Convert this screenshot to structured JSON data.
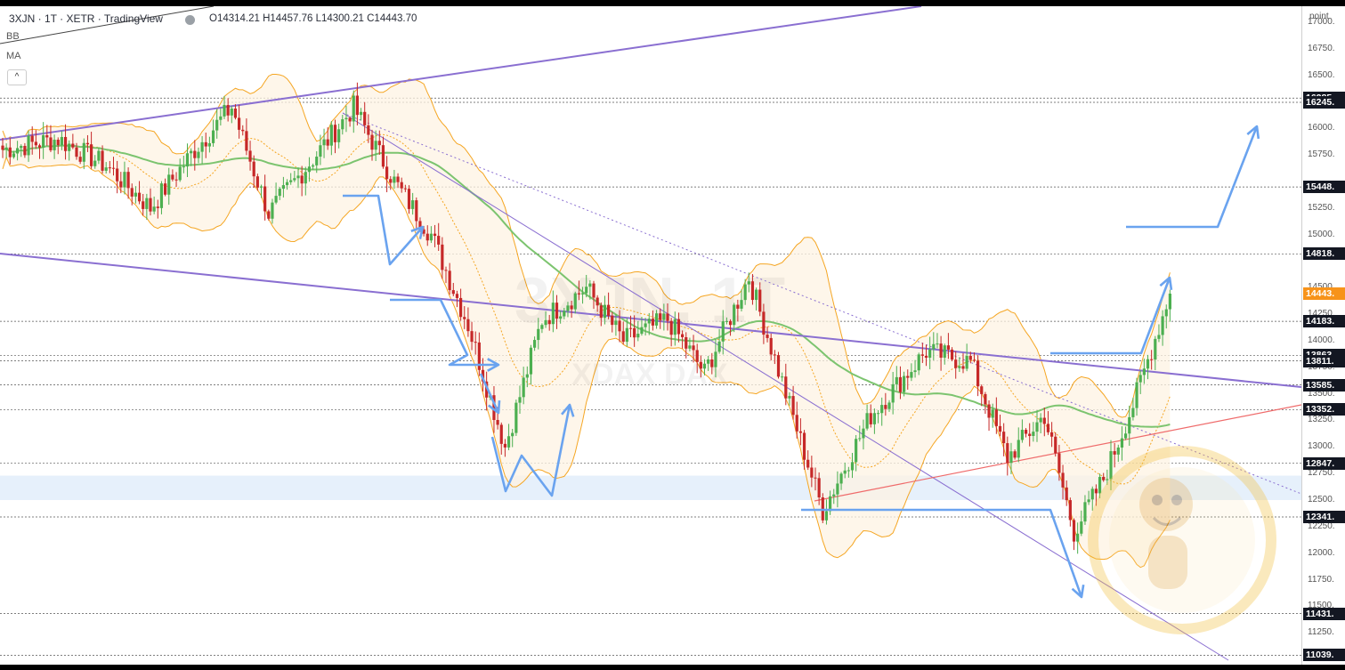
{
  "header": {
    "symbol": "3XJN · 1T · XETR · TradingView",
    "ohlc": "O14314.21 H14457.76 L14300.21 C14443.70"
  },
  "indicators": [
    "BB",
    "MA"
  ],
  "collapse_icon": "chevron-up-icon",
  "watermark": {
    "title": "3XJN, 1T",
    "subtitle": "XDAX DAX"
  },
  "axis": {
    "unit": "point",
    "ticks": [
      "17000.",
      "16750.",
      "16500.",
      "16000.",
      "15750.",
      "15250.",
      "15000.",
      "14500.",
      "14250.",
      "14000.",
      "13750.",
      "13500.",
      "13250.",
      "13000.",
      "12750.",
      "12500.",
      "12250.",
      "12000.",
      "11750.",
      "11500.",
      "11250."
    ],
    "price_labels": [
      "16285.",
      "16245.",
      "15448.",
      "14818.",
      "14443.",
      "14183.",
      "13863.",
      "13811.",
      "13585.",
      "13352.",
      "12847.",
      "12341.",
      "11431.",
      "11039."
    ],
    "current_price_label": "14443."
  },
  "colors": {
    "up": "#4caf50",
    "down": "#c62828",
    "bb_band": "#f5a623",
    "bb_fill": "#fdf3e3",
    "ma": "#7cc46f",
    "trend_purple": "#8a6fd1",
    "trend_red": "#ef6b6b",
    "annotation_blue": "#6aa3ef",
    "support_zone": "#e6f0fb",
    "label_bg": "#131722",
    "current_bg": "#f7931a"
  },
  "chart_data": {
    "type": "candlestick",
    "ylim": [
      10950,
      17150
    ],
    "horizontal_levels": [
      16285,
      16245,
      15448,
      14818,
      14183,
      13863,
      13811,
      13585,
      13352,
      12847,
      12341,
      11431,
      11039
    ],
    "support_zone": [
      12500,
      12730
    ],
    "waypoints": [
      [
        0,
        15800
      ],
      [
        15,
        15900
      ],
      [
        28,
        15650
      ],
      [
        40,
        15250
      ],
      [
        52,
        15800
      ],
      [
        62,
        16200
      ],
      [
        72,
        15200
      ],
      [
        86,
        15800
      ],
      [
        95,
        16200
      ],
      [
        106,
        15500
      ],
      [
        116,
        15000
      ],
      [
        126,
        14150
      ],
      [
        136,
        13000
      ],
      [
        146,
        14200
      ],
      [
        158,
        14500
      ],
      [
        168,
        14000
      ],
      [
        180,
        14200
      ],
      [
        190,
        13700
      ],
      [
        202,
        14600
      ],
      [
        212,
        13500
      ],
      [
        222,
        12400
      ],
      [
        235,
        13300
      ],
      [
        250,
        13900
      ],
      [
        262,
        13800
      ],
      [
        272,
        12900
      ],
      [
        282,
        13300
      ],
      [
        290,
        12200
      ],
      [
        298,
        12700
      ],
      [
        306,
        13400
      ],
      [
        316,
        14443
      ]
    ],
    "current_close": 14443.7
  }
}
